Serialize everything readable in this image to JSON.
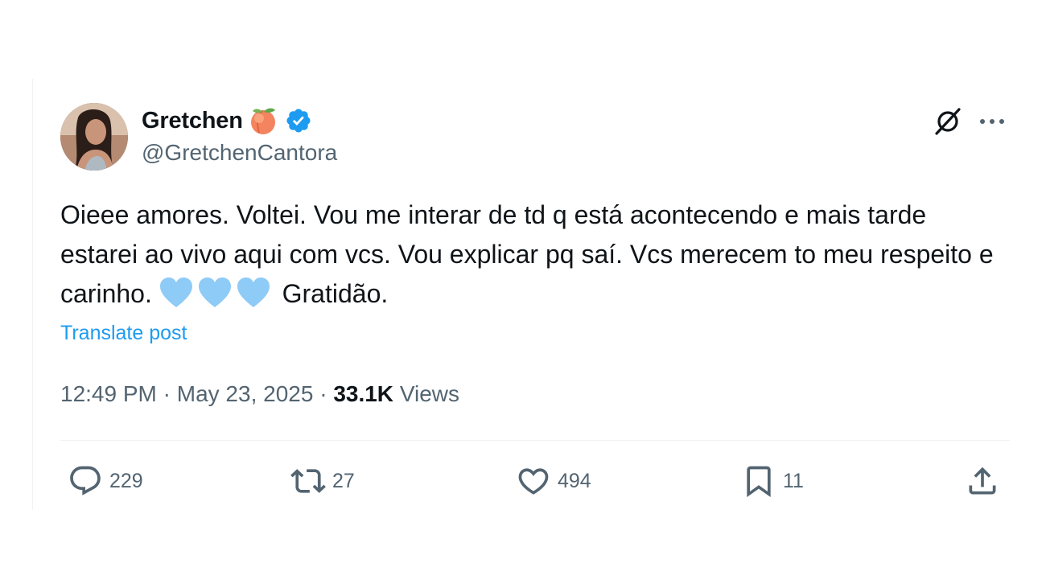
{
  "author": {
    "display_name": "Gretchen",
    "handle": "@GretchenCantora",
    "name_emoji": "peach-emoji",
    "verified": true,
    "verified_color": "#1d9bf0"
  },
  "post": {
    "text_before_emoji": "Oieee amores. Voltei. Vou me interar de td q está acontecendo e mais tarde estarei ao vivo aqui com vcs. Vou explicar pq saí. Vcs merecem to meu respeito e carinho.",
    "emoji": [
      "light-blue-heart",
      "light-blue-heart",
      "light-blue-heart"
    ],
    "text_after_emoji": "Gratidão.",
    "translate_label": "Translate post"
  },
  "meta": {
    "time": "12:49 PM",
    "separator": "·",
    "date": "May 23, 2025",
    "views_count": "33.1K",
    "views_label": "Views"
  },
  "actions": {
    "replies": "229",
    "reposts": "27",
    "likes": "494",
    "bookmarks": "11"
  },
  "colors": {
    "accent": "#1d9bf0",
    "muted": "#536471",
    "text": "#0f1419",
    "heart_emoji": "#8ecbf6"
  }
}
